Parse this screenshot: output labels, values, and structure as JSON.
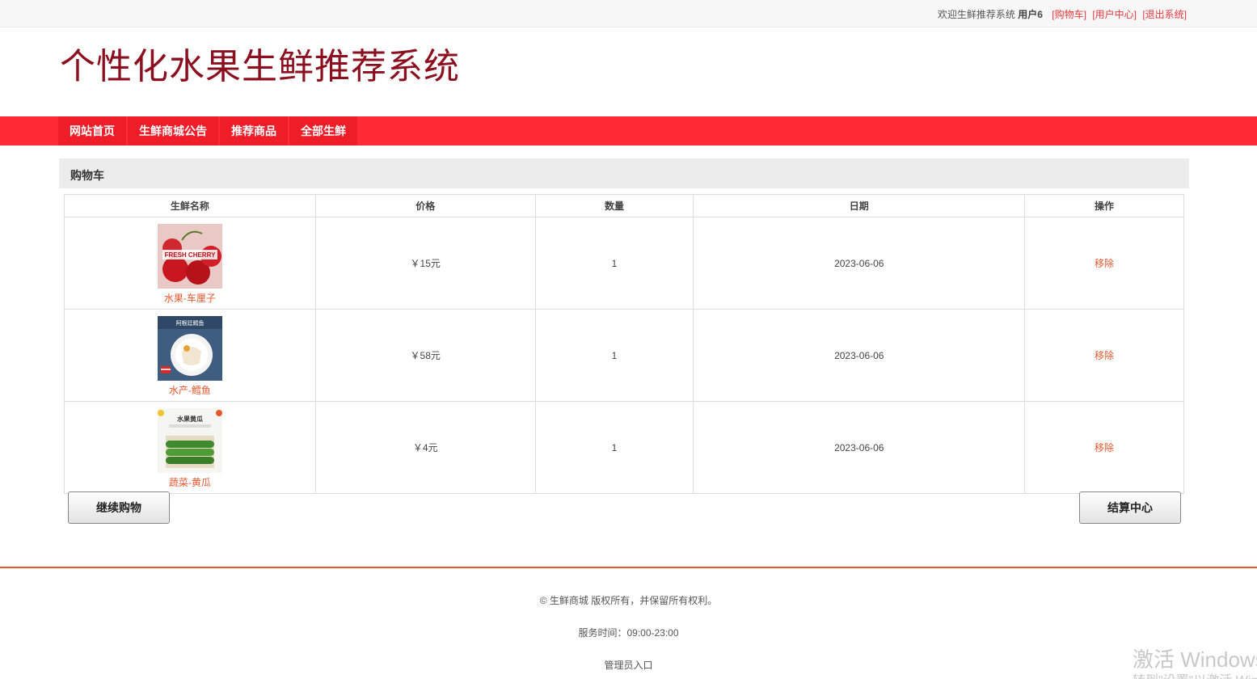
{
  "topbar": {
    "welcome": "欢迎生鲜推荐系统",
    "username": "用户6",
    "links": [
      "[购物车]",
      "[用户中心]",
      "[退出系统]"
    ]
  },
  "site": {
    "title": "个性化水果生鲜推荐系统"
  },
  "nav": {
    "items": [
      "网站首页",
      "生鲜商城公告",
      "推荐商品",
      "全部生鲜"
    ]
  },
  "cart": {
    "heading": "购物车",
    "columns": [
      "生鲜名称",
      "价格",
      "数量",
      "日期",
      "操作"
    ],
    "rows": [
      {
        "name": "水果-车厘子",
        "price": "￥15元",
        "qty": "1",
        "date": "2023-06-06",
        "action": "移除",
        "thumb_text": "FRESH CHERRY"
      },
      {
        "name": "水产-鳕鱼",
        "price": "￥58元",
        "qty": "1",
        "date": "2023-06-06",
        "action": "移除",
        "thumb_text": "阿根廷鳕鱼"
      },
      {
        "name": "蔬菜-黄瓜",
        "price": "￥4元",
        "qty": "1",
        "date": "2023-06-06",
        "action": "移除",
        "thumb_text": "水果黄瓜"
      }
    ],
    "continue_label": "继续购物",
    "checkout_label": "结算中心"
  },
  "footer": {
    "copyright": "© 生鲜商城 版权所有，并保留所有权利。",
    "hours": "服务时间：09:00-23:00",
    "admin": "管理员入口"
  },
  "watermark": {
    "line1": "激活 Windows",
    "line2": "转到\"设置\"以激活 Windows。"
  }
}
